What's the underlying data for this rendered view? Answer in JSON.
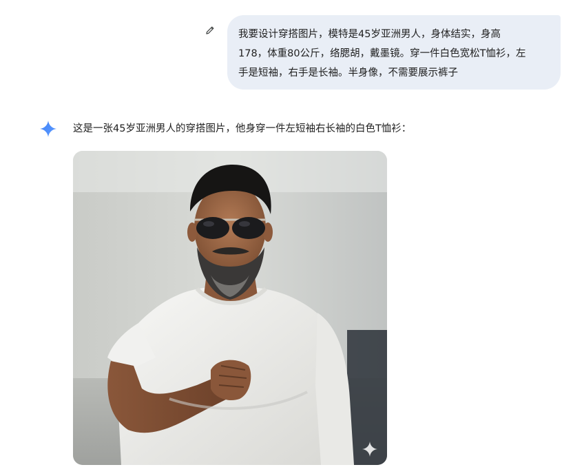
{
  "user_message": {
    "lines": [
      "我要设计穿搭图片，模特是45岁亚洲男人，身体结实，身高",
      "178，体重80公斤，络腮胡，戴墨镜。穿一件白色宽松T恤衫，左",
      "手是短袖，右手是长袖。半身像，不需要展示裤子"
    ],
    "edit_icon": "pencil-icon"
  },
  "model_response": {
    "avatar_icon": "gemini-sparkle-icon",
    "text": "这是一张45岁亚洲男人的穿搭图片，他身穿一件左短袖右长袖的白色T恤衫：",
    "image": {
      "subject": "generated-photo",
      "watermark_icon": "sparkle-icon"
    }
  },
  "colors": {
    "user_bubble": "#e9eef6",
    "gemini_blue": "#4285f4",
    "text": "#1f1f1f"
  }
}
